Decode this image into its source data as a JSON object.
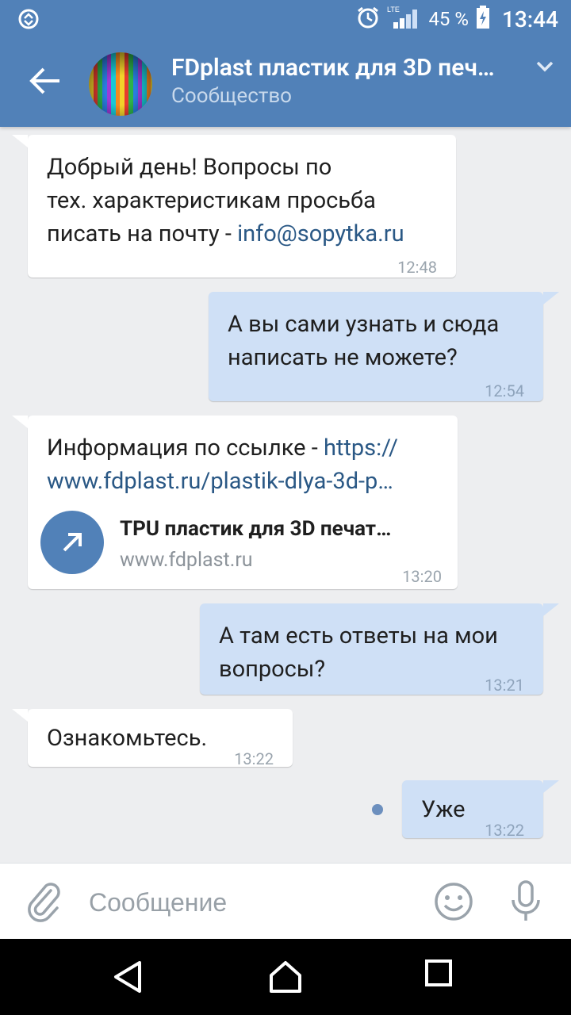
{
  "status": {
    "network": "LTE",
    "battery": "45 %",
    "time": "13:44"
  },
  "header": {
    "title": "FDplast пластик для 3D печ…",
    "subtitle": "Сообщество"
  },
  "messages": [
    {
      "direction": "in",
      "lines": [
        "Добрый день! Вопросы по",
        "тех. характеристикам просьба"
      ],
      "line3_prefix": "писать на почту - ",
      "line3_link": "info@sopytka.ru",
      "time": "12:48"
    },
    {
      "direction": "out",
      "lines": [
        "А вы сами узнать и сюда",
        "написать не можете?"
      ],
      "time": "12:54"
    },
    {
      "direction": "in",
      "line1_prefix": "Информация по ссылке - ",
      "line1_link": "https://",
      "line2_link": "www.fdplast.ru/plastik-dlya-3d-p…",
      "link_card": {
        "title": "TPU пластик для 3D печат…",
        "url": "www.fdplast.ru"
      },
      "time": "13:20"
    },
    {
      "direction": "out",
      "lines": [
        "А там есть ответы на мои",
        "вопросы?"
      ],
      "time": "13:21"
    },
    {
      "direction": "in",
      "lines": [
        "Ознакомьтесь."
      ],
      "time": "13:22"
    },
    {
      "direction": "out",
      "lines": [
        "Уже"
      ],
      "time": "13:22",
      "unread": true
    }
  ],
  "input": {
    "placeholder": "Сообщение"
  },
  "colors": {
    "header": "#5181b8",
    "incoming_bubble": "#ffffff",
    "outgoing_bubble": "#cfe0f6",
    "link": "#2a5885",
    "background": "#edeef0"
  }
}
